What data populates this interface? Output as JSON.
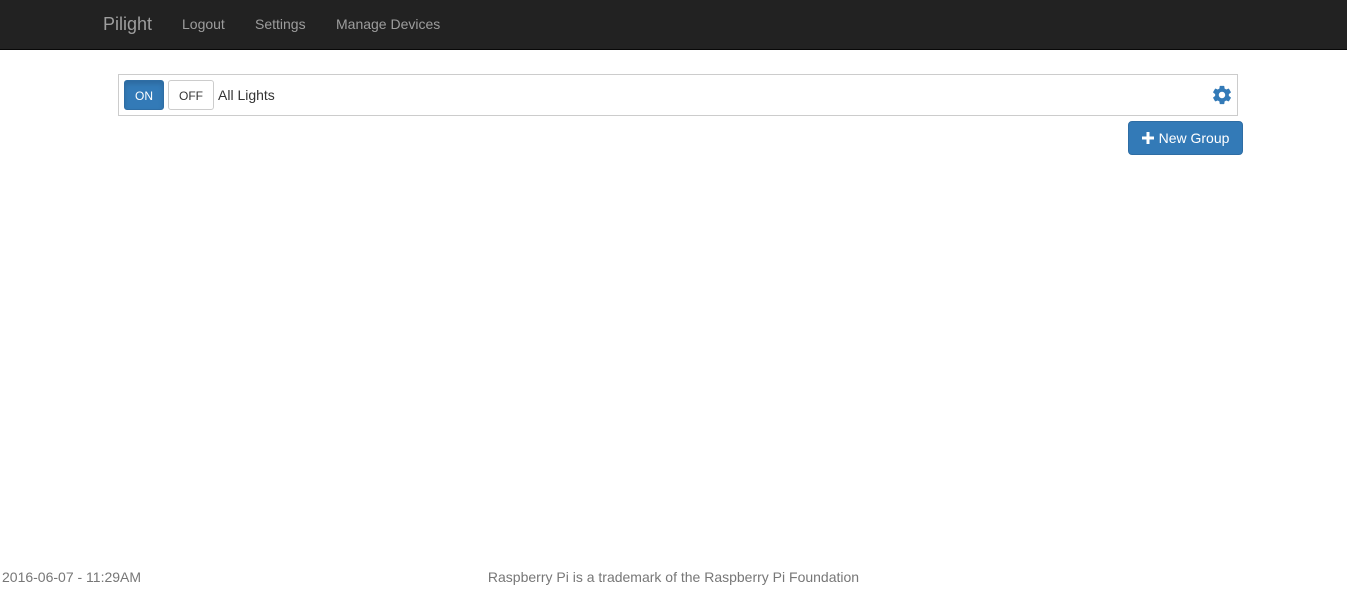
{
  "navbar": {
    "brand": "Pilight",
    "links": [
      {
        "label": "Logout"
      },
      {
        "label": "Settings"
      },
      {
        "label": "Manage Devices"
      }
    ]
  },
  "group": {
    "on_label": "ON",
    "off_label": "OFF",
    "name": "All Lights",
    "settings_icon": "gear-icon",
    "state": "ON"
  },
  "actions": {
    "new_group_label": "New Group",
    "new_group_icon": "plus-icon"
  },
  "footer": {
    "datetime": "2016-06-07 - 11:29AM",
    "trademark": "Raspberry Pi is a trademark of the Raspberry Pi Foundation"
  },
  "colors": {
    "navbar_bg": "#222222",
    "navbar_text": "#9d9d9d",
    "primary": "#337ab7",
    "footer_text": "#777777"
  }
}
